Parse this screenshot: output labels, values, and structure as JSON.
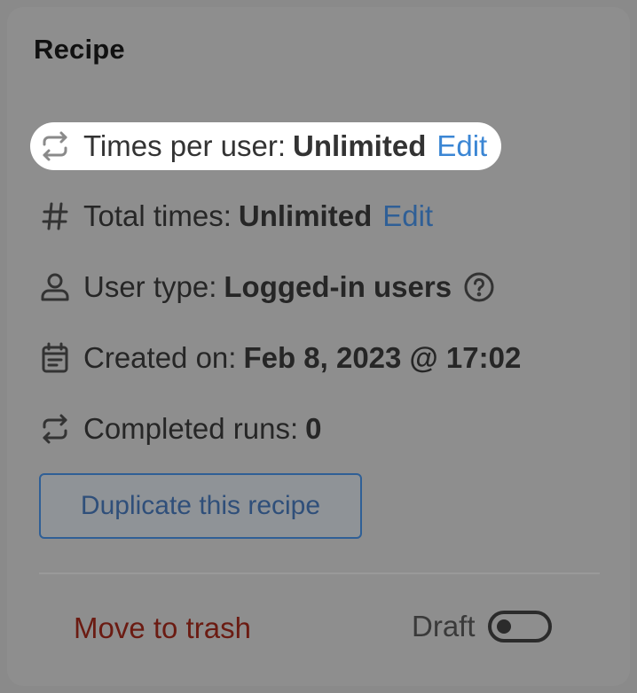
{
  "panel": {
    "title": "Recipe"
  },
  "rows": {
    "times_per_user": {
      "label": "Times per user:",
      "value": "Unlimited",
      "edit": "Edit",
      "icon": "repeat-icon"
    },
    "total_times": {
      "label": "Total times:",
      "value": "Unlimited",
      "edit": "Edit",
      "icon": "hash-icon"
    },
    "user_type": {
      "label": "User type:",
      "value": "Logged-in users",
      "icon": "user-icon",
      "help_icon": "question-circle-icon"
    },
    "created_on": {
      "label": "Created on:",
      "value": "Feb 8, 2023 @ 17:02",
      "icon": "calendar-icon"
    },
    "completed_runs": {
      "label": "Completed runs:",
      "value": "0",
      "icon": "repeat-icon"
    }
  },
  "actions": {
    "duplicate_label": "Duplicate this recipe",
    "trash_label": "Move to trash",
    "status_label": "Draft",
    "status_toggle_on": false
  },
  "colors": {
    "link": "#3b86d4",
    "link_dimmed": "#2f5f96",
    "danger": "#6b1b12",
    "overlay": "#8a8a8a",
    "highlight_bg": "#ffffff"
  }
}
